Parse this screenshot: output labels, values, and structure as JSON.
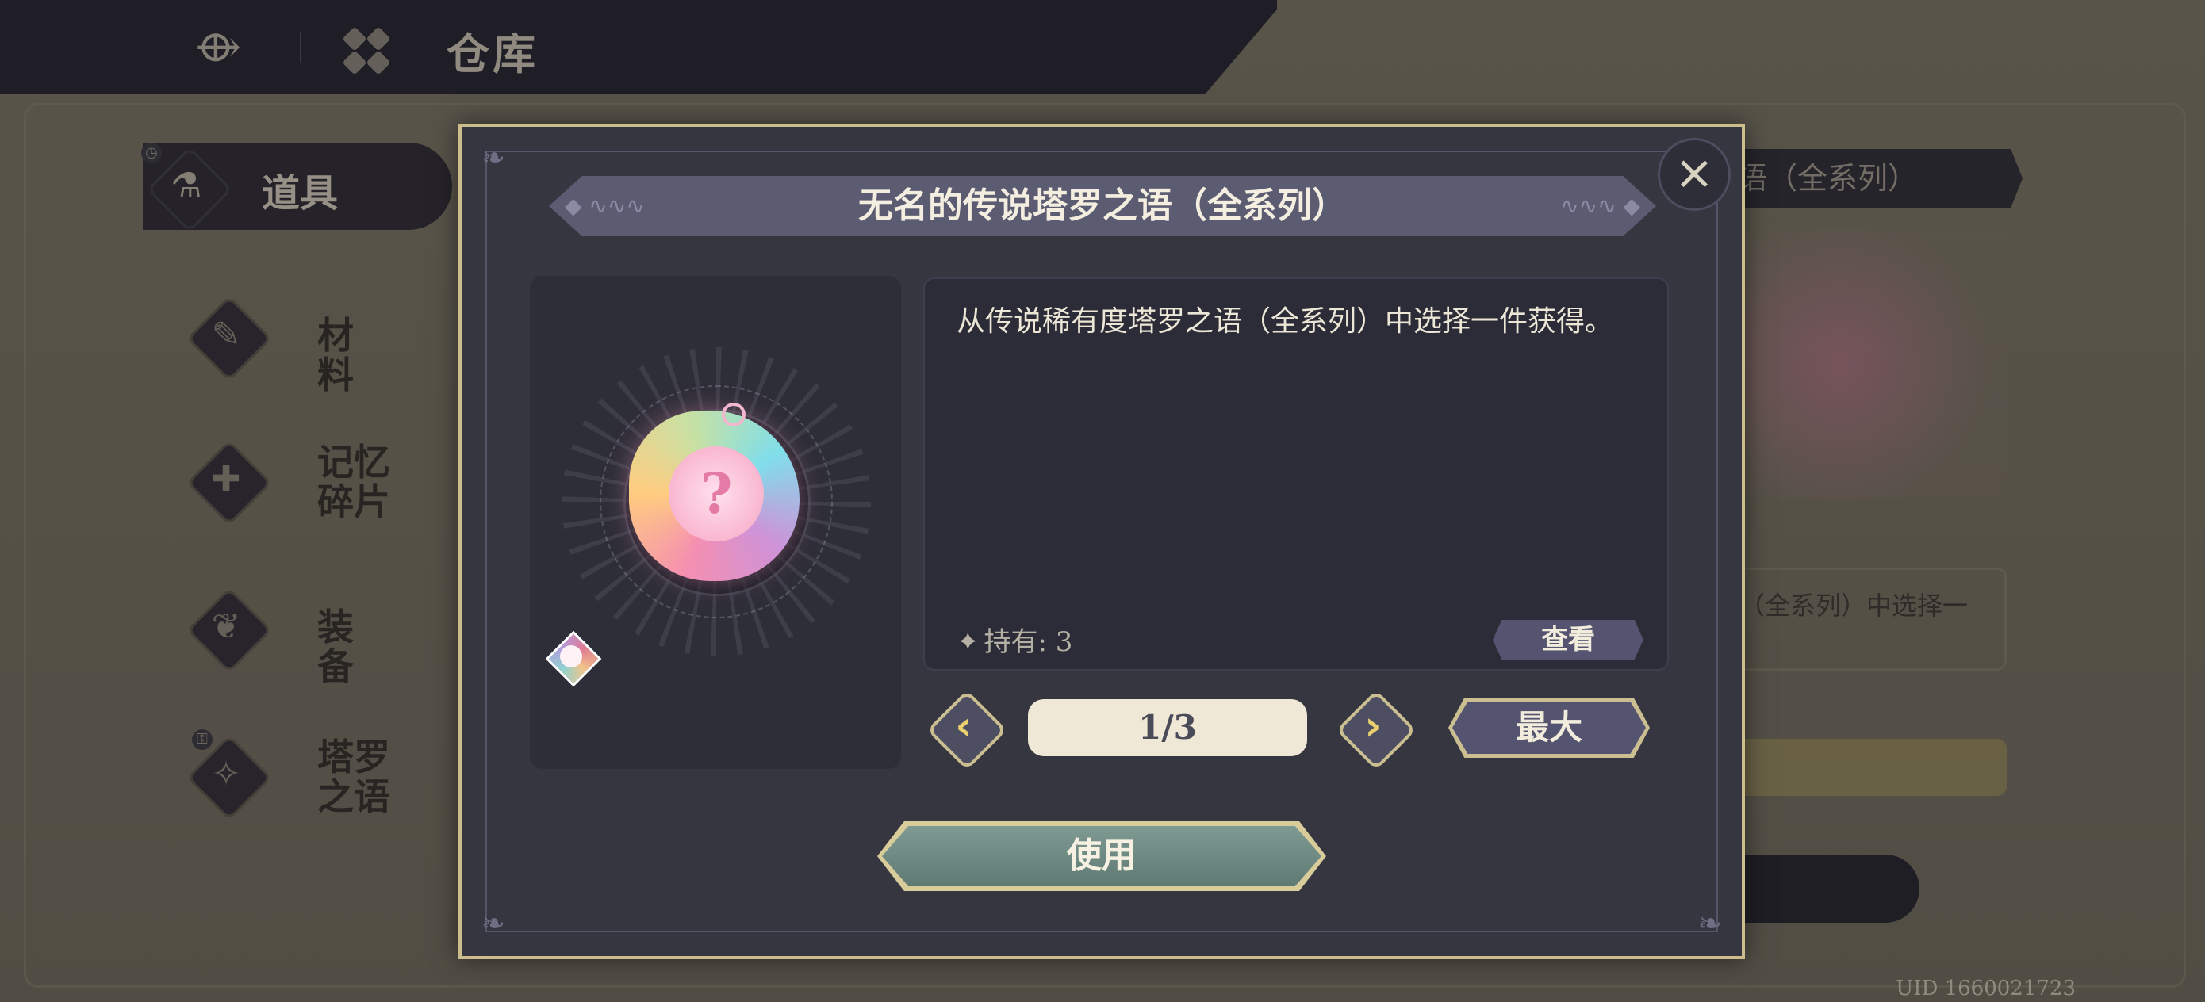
{
  "header": {
    "title": "仓库",
    "back_icon": "back-arrow-icon",
    "home_icon": "home-grid-icon"
  },
  "sidebar": {
    "items": [
      {
        "label": "道具",
        "icon": "potion-icon",
        "active": true
      },
      {
        "label": "材料",
        "icon": "scroll-icon",
        "active": false
      },
      {
        "label": "记忆\n碎片",
        "icon": "puzzle-icon",
        "active": false
      },
      {
        "label": "装备",
        "icon": "equipment-icon",
        "active": false
      },
      {
        "label": "塔罗\n之语",
        "icon": "tarot-icon",
        "active": false
      }
    ]
  },
  "background_detail": {
    "title_fragment": "语（全系列）",
    "desc_fragment": "（全系列）中选择一"
  },
  "uid_text": "UID 1660021723",
  "modal": {
    "title": "无名的传说塔罗之语（全系列）",
    "description": "从传说稀有度塔罗之语（全系列）中选择一件获得。",
    "owned_label": "持有: 3",
    "view_button": "查看",
    "quantity": "1/3",
    "quantity_current": 1,
    "quantity_max": 3,
    "max_button": "最大",
    "use_button": "使用",
    "close_icon": "close-icon"
  },
  "colors": {
    "modal_border": "#cbbe8c",
    "modal_bg": "#363641",
    "accent_gold": "#e9cf6e",
    "use_button": "#6f8a82"
  }
}
